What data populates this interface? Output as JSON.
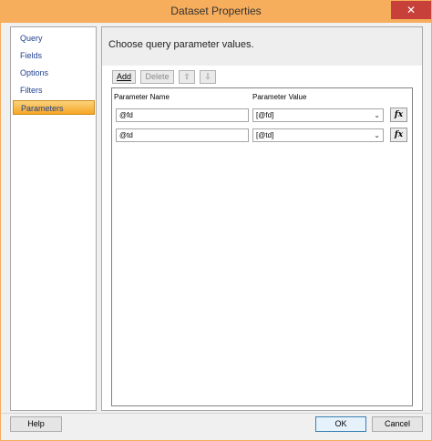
{
  "window": {
    "title": "Dataset Properties",
    "close_glyph": "✕"
  },
  "nav": {
    "items": [
      {
        "label": "Query"
      },
      {
        "label": "Fields"
      },
      {
        "label": "Options"
      },
      {
        "label": "Filters"
      },
      {
        "label": "Parameters",
        "selected": true
      }
    ]
  },
  "content": {
    "heading": "Choose query parameter values.",
    "toolbar": {
      "add_label": "Add",
      "delete_label": "Delete",
      "up_glyph": "⇧",
      "down_glyph": "⇩"
    },
    "columns": {
      "name": "Parameter Name",
      "value": "Parameter Value"
    },
    "rows": [
      {
        "name": "@fd",
        "value": "[@fd]"
      },
      {
        "name": "@td",
        "value": "[@td]"
      }
    ],
    "fx_label": "fx"
  },
  "footer": {
    "help_label": "Help",
    "ok_label": "OK",
    "cancel_label": "Cancel"
  },
  "colors": {
    "accent": "#f6ad5c",
    "close": "#c7403a",
    "selected_nav": "#f5a623"
  }
}
